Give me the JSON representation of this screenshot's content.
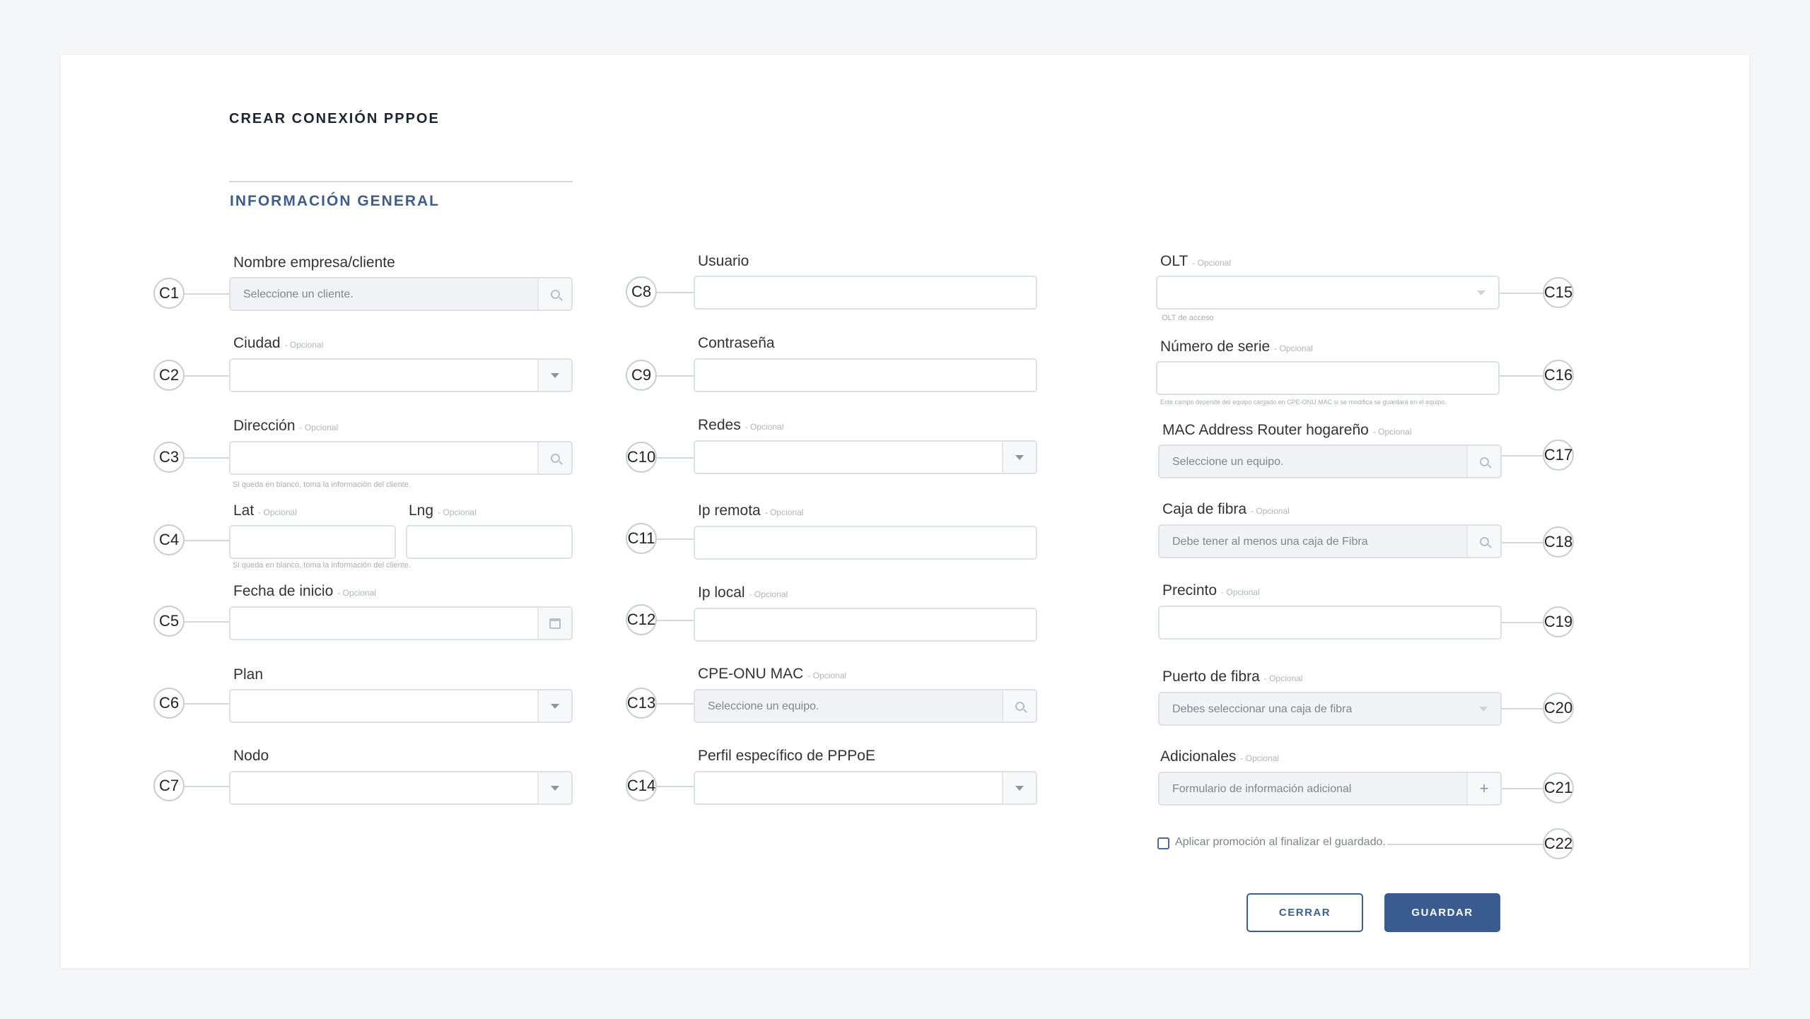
{
  "title": "CREAR CONEXIÓN PPPOE",
  "section": "INFORMACIÓN GENERAL",
  "optional_tag": "- Opcional",
  "fields": {
    "nombre": {
      "label": "Nombre empresa/cliente",
      "placeholder": "Seleccione un cliente.",
      "icon": "search-icon"
    },
    "ciudad": {
      "label": "Ciudad",
      "icon": "chevron-down-icon"
    },
    "direccion": {
      "label": "Dirección",
      "icon": "search-icon",
      "help": "Si queda en blanco, toma la información del cliente."
    },
    "lat": {
      "label": "Lat"
    },
    "lng": {
      "label": "Lng",
      "help": "Si queda en blanco, toma la información del cliente."
    },
    "fecha": {
      "label": "Fecha de inicio",
      "icon": "calendar-icon"
    },
    "plan": {
      "label": "Plan",
      "icon": "chevron-down-icon"
    },
    "nodo": {
      "label": "Nodo",
      "icon": "chevron-down-icon"
    },
    "usuario": {
      "label": "Usuario"
    },
    "contrasena": {
      "label": "Contraseña"
    },
    "redes": {
      "label": "Redes",
      "icon": "chevron-down-icon"
    },
    "ip_remota": {
      "label": "Ip remota"
    },
    "ip_local": {
      "label": "Ip local"
    },
    "cpe": {
      "label": "CPE-ONU MAC",
      "placeholder": "Seleccione un equipo.",
      "icon": "search-icon"
    },
    "perfil": {
      "label": "Perfil específico de PPPoE",
      "icon": "chevron-down-icon"
    },
    "olt": {
      "label": "OLT",
      "help": "OLT de acceso",
      "icon": "chevron-down-icon"
    },
    "serie": {
      "label": "Número de serie",
      "help": "Este campo depende del equipo cargado en CPE-ONU MAC si se modifica se guardará en el equipo."
    },
    "mac_router": {
      "label": "MAC Address Router hogareño",
      "placeholder": "Seleccione un equipo.",
      "icon": "search-icon"
    },
    "caja": {
      "label": "Caja de fibra",
      "placeholder": "Debe tener al menos una caja de Fibra",
      "icon": "search-icon"
    },
    "precinto": {
      "label": "Precinto"
    },
    "puerto": {
      "label": "Puerto de fibra",
      "placeholder": "Debes seleccionar una caja de fibra",
      "icon": "chevron-down-icon"
    },
    "adicionales": {
      "label": "Adicionales",
      "placeholder": "Formulario de información adicional",
      "icon": "plus-icon"
    }
  },
  "promo_checkbox": {
    "label": "Aplicar promoción al finalizar el guardado.",
    "checked": false
  },
  "markers": [
    "C1",
    "C2",
    "C3",
    "C4",
    "C5",
    "C6",
    "C7",
    "C8",
    "C9",
    "C10",
    "C11",
    "C12",
    "C13",
    "C14",
    "C15",
    "C16",
    "C17",
    "C18",
    "C19",
    "C20",
    "C21",
    "C22"
  ],
  "buttons": {
    "close": "CERRAR",
    "save": "GUARDAR"
  },
  "colors": {
    "accent": "#3a5b8f",
    "section": "#3f5d8a",
    "border": "#dde1e6"
  }
}
